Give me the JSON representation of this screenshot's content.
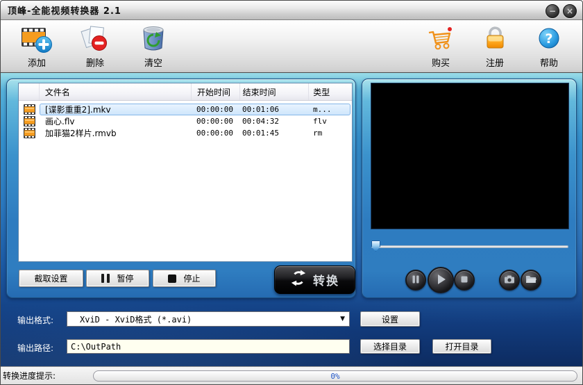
{
  "window": {
    "title": "顶峰-全能视频转换器 2.1",
    "controls": {
      "minimize": "−",
      "close": "×"
    }
  },
  "toolbar": {
    "left_items": [
      {
        "name": "add",
        "label": "添加",
        "icon": "film-add-icon"
      },
      {
        "name": "delete",
        "label": "删除",
        "icon": "delete-pages-icon"
      },
      {
        "name": "clear",
        "label": "清空",
        "icon": "recycle-bin-icon"
      }
    ],
    "right_items": [
      {
        "name": "buy",
        "label": "购买",
        "icon": "shopping-cart-icon"
      },
      {
        "name": "register",
        "label": "注册",
        "icon": "padlock-icon"
      },
      {
        "name": "help",
        "label": "帮助",
        "icon": "question-icon"
      }
    ]
  },
  "file_list": {
    "columns": {
      "name": "文件名",
      "start": "开始时间",
      "end": "结束时间",
      "type": "类型"
    },
    "rows": [
      {
        "name": "[谍影重重2].mkv",
        "start": "00:00:00",
        "end": "00:01:06",
        "type": "m...",
        "selected": true
      },
      {
        "name": "画心.flv",
        "start": "00:00:00",
        "end": "00:04:32",
        "type": "flv",
        "selected": false
      },
      {
        "name": "加菲猫2样片.rmvb",
        "start": "00:00:00",
        "end": "00:01:45",
        "type": "rm",
        "selected": false
      }
    ]
  },
  "actions": {
    "capture_settings": "截取设置",
    "pause": "暂停",
    "stop": "停止",
    "convert": "转换"
  },
  "player": {
    "buttons": [
      {
        "icon": "pause-icon"
      },
      {
        "icon": "play-icon"
      },
      {
        "icon": "stop-icon"
      },
      {
        "icon": "snapshot-camera-icon"
      },
      {
        "icon": "open-folder-icon"
      }
    ],
    "seek_position_percent": 0
  },
  "output_format": {
    "label": "输出格式:",
    "value": "XviD - XviD格式 (*.avi)",
    "settings_button": "设置"
  },
  "output_path": {
    "label": "输出路径:",
    "value": "C:\\OutPath",
    "choose_button": "选择目录",
    "open_button": "打开目录"
  },
  "status": {
    "label": "转换进度提示:",
    "progress_text": "0%",
    "progress_percent": 0
  },
  "colors": {
    "content_blue": "#2a77bd",
    "panel_blue": "#3b92cc",
    "selected_row": "#cfe6fc",
    "accent_orange": "#f59c1f",
    "help_blue": "#2b9be0",
    "progress_text": "#2157c8"
  }
}
